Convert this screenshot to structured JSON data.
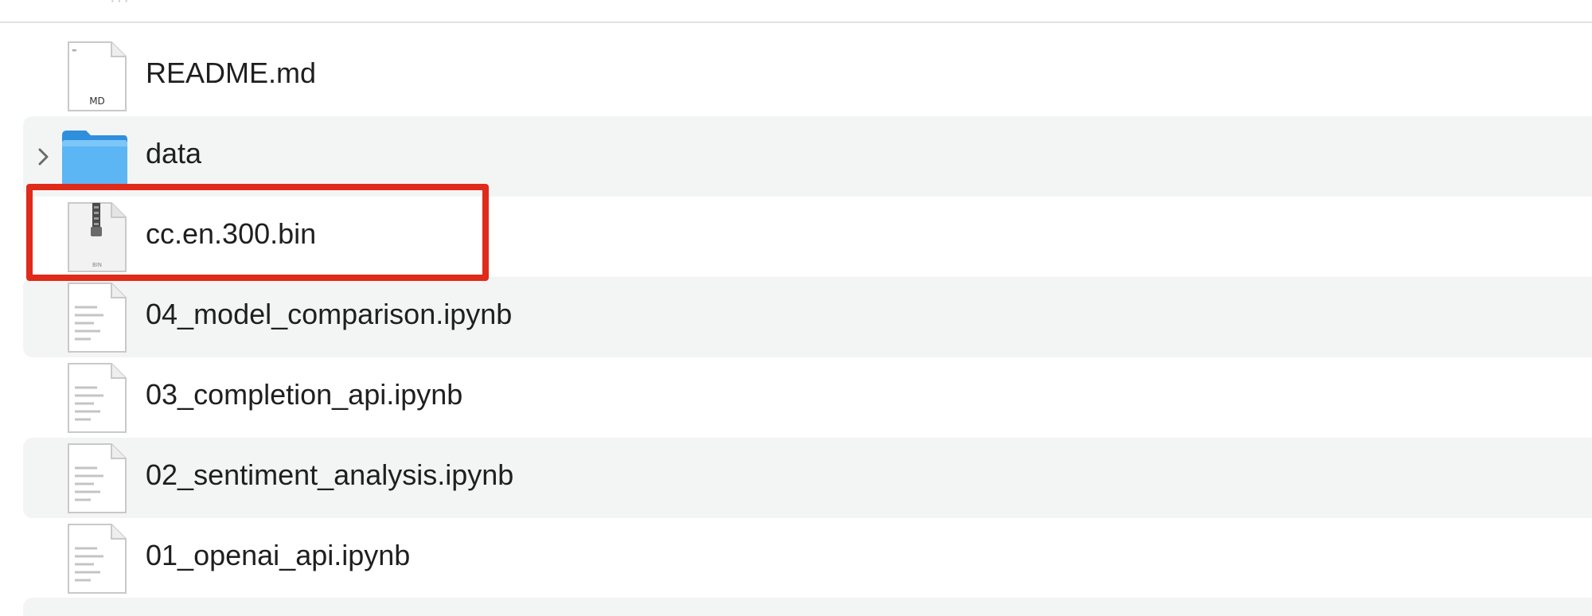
{
  "header": {
    "faint_text": "···"
  },
  "files": [
    {
      "name": "README.md",
      "kind": "markdown",
      "icon": "markdown-file-icon",
      "badge": "MD",
      "expandable": false
    },
    {
      "name": "data",
      "kind": "folder",
      "icon": "folder-icon",
      "expandable": true
    },
    {
      "name": "cc.en.300.bin",
      "kind": "binary",
      "icon": "binary-file-icon",
      "badge": "BIN",
      "expandable": false,
      "highlighted": true
    },
    {
      "name": "04_model_comparison.ipynb",
      "kind": "document",
      "icon": "document-file-icon",
      "expandable": false
    },
    {
      "name": "03_completion_api.ipynb",
      "kind": "document",
      "icon": "document-file-icon",
      "expandable": false
    },
    {
      "name": "02_sentiment_analysis.ipynb",
      "kind": "document",
      "icon": "document-file-icon",
      "expandable": false
    },
    {
      "name": "01_openai_api.ipynb",
      "kind": "document",
      "icon": "document-file-icon",
      "expandable": false
    }
  ],
  "colors": {
    "stripe": "#f3f4f4",
    "highlight": "#e02a1a",
    "folder": "#3aa0ea",
    "text": "#1f1f1f"
  }
}
